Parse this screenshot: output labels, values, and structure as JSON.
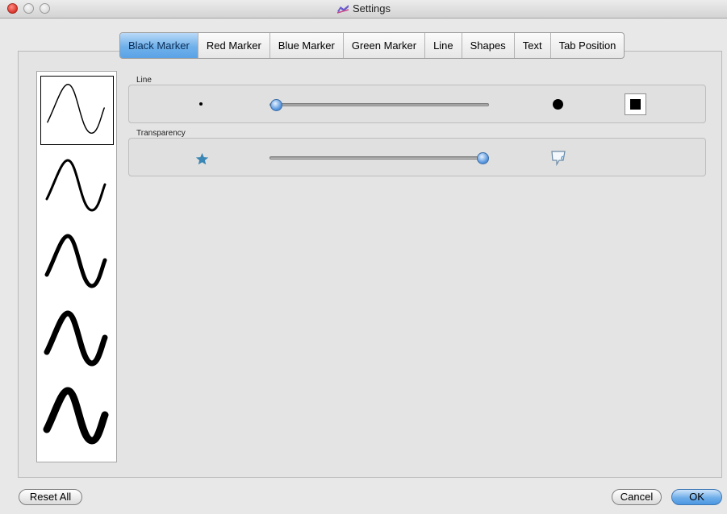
{
  "window": {
    "title": "Settings"
  },
  "tabs": [
    {
      "label": "Black Marker",
      "active": true
    },
    {
      "label": "Red Marker",
      "active": false
    },
    {
      "label": "Blue Marker",
      "active": false
    },
    {
      "label": "Green Marker",
      "active": false
    },
    {
      "label": "Line",
      "active": false
    },
    {
      "label": "Shapes",
      "active": false
    },
    {
      "label": "Text",
      "active": false
    },
    {
      "label": "Tab Position",
      "active": false
    }
  ],
  "line_group": {
    "label": "Line",
    "slider_value": 0.03,
    "color": "#000000"
  },
  "transparency_group": {
    "label": "Transparency",
    "slider_value": 0.97
  },
  "previews": [
    {
      "stroke": 1.5,
      "selected": true
    },
    {
      "stroke": 3,
      "selected": false
    },
    {
      "stroke": 5,
      "selected": false
    },
    {
      "stroke": 7,
      "selected": false
    },
    {
      "stroke": 9,
      "selected": false
    }
  ],
  "buttons": {
    "reset": "Reset All",
    "cancel": "Cancel",
    "ok": "OK"
  },
  "colors": {
    "accent": "#5ba3e6",
    "star": "#3a86b4"
  }
}
